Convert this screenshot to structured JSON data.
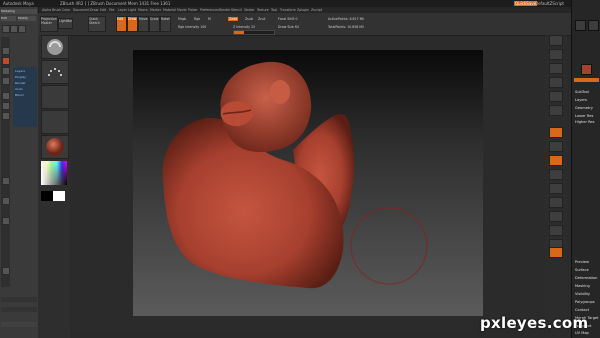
{
  "titlebar": {
    "maya_title": "Autodesk Maya",
    "zbrush_title": "ZBrush 4R2 [ ] ZBrush Document Mem 1431 Free 1361",
    "quicksave": "QuickSave",
    "default_label": "DefaultZScript"
  },
  "menu": [
    "Alpha",
    "Brush",
    "Color",
    "Document",
    "Draw",
    "Edit",
    "File",
    "Layer",
    "Light",
    "Macro",
    "Marker",
    "Material",
    "Movie",
    "Picker",
    "Preferences",
    "Render",
    "Stencil",
    "Stroke",
    "Texture",
    "Tool",
    "Transform",
    "Zplugin",
    "Zscript"
  ],
  "toolbar": {
    "projection_master": "Projection Master",
    "lightbox": "LightBox",
    "quick_sketch": "Quick Sketch",
    "edit": "Edit",
    "draw": "Draw",
    "move": "Move",
    "scale": "Scale",
    "rotate": "Rotate",
    "mrgb": "Mrgb",
    "rgb": "Rgb",
    "m": "M",
    "zadd": "Zadd",
    "zsub": "Zsub",
    "zcut": "Zcut",
    "focal_shift": "Focal Shift 0",
    "draw_size": "Draw Size 64",
    "z_intensity": "Z Intensity 25",
    "rgb_intensity": "Rgb Intensity 100",
    "active_points": "ActivePoints: 6.617 Mil",
    "total_points": "TotalPoints: 10.658 Mil",
    "z_intensity_value": 0.25,
    "rgb_intensity_value": 1.0
  },
  "maya": {
    "menu_items": [
      "Modeling",
      "Edit",
      "Modify"
    ],
    "layers": [
      "Layers",
      "Display",
      "Render"
    ],
    "blue_items": [
      "Layers",
      "Display",
      "Render",
      "Anim",
      "Blend"
    ]
  },
  "right_panel": {
    "items": [
      "SubTool",
      "Layers",
      "Geometry",
      "Lower Res",
      "Higher Res",
      "Preview",
      "Surface",
      "Deformation",
      "Masking",
      "Visibility",
      "Polygroups",
      "Contact",
      "Morph Target",
      "Polypaint",
      "UV Map",
      "Texture Map",
      "Displacement"
    ],
    "orange_label": "Rend"
  },
  "colors": {
    "accent": "#d9691a",
    "clay": "#a8402f",
    "background": "#2b2b2b"
  },
  "left_tray": {
    "brush_icon": "brush-icon",
    "stroke_icon": "stroke-icon",
    "material": "material-sphere",
    "color_picker": "color-picker"
  },
  "watermark": "pxleyes.com"
}
